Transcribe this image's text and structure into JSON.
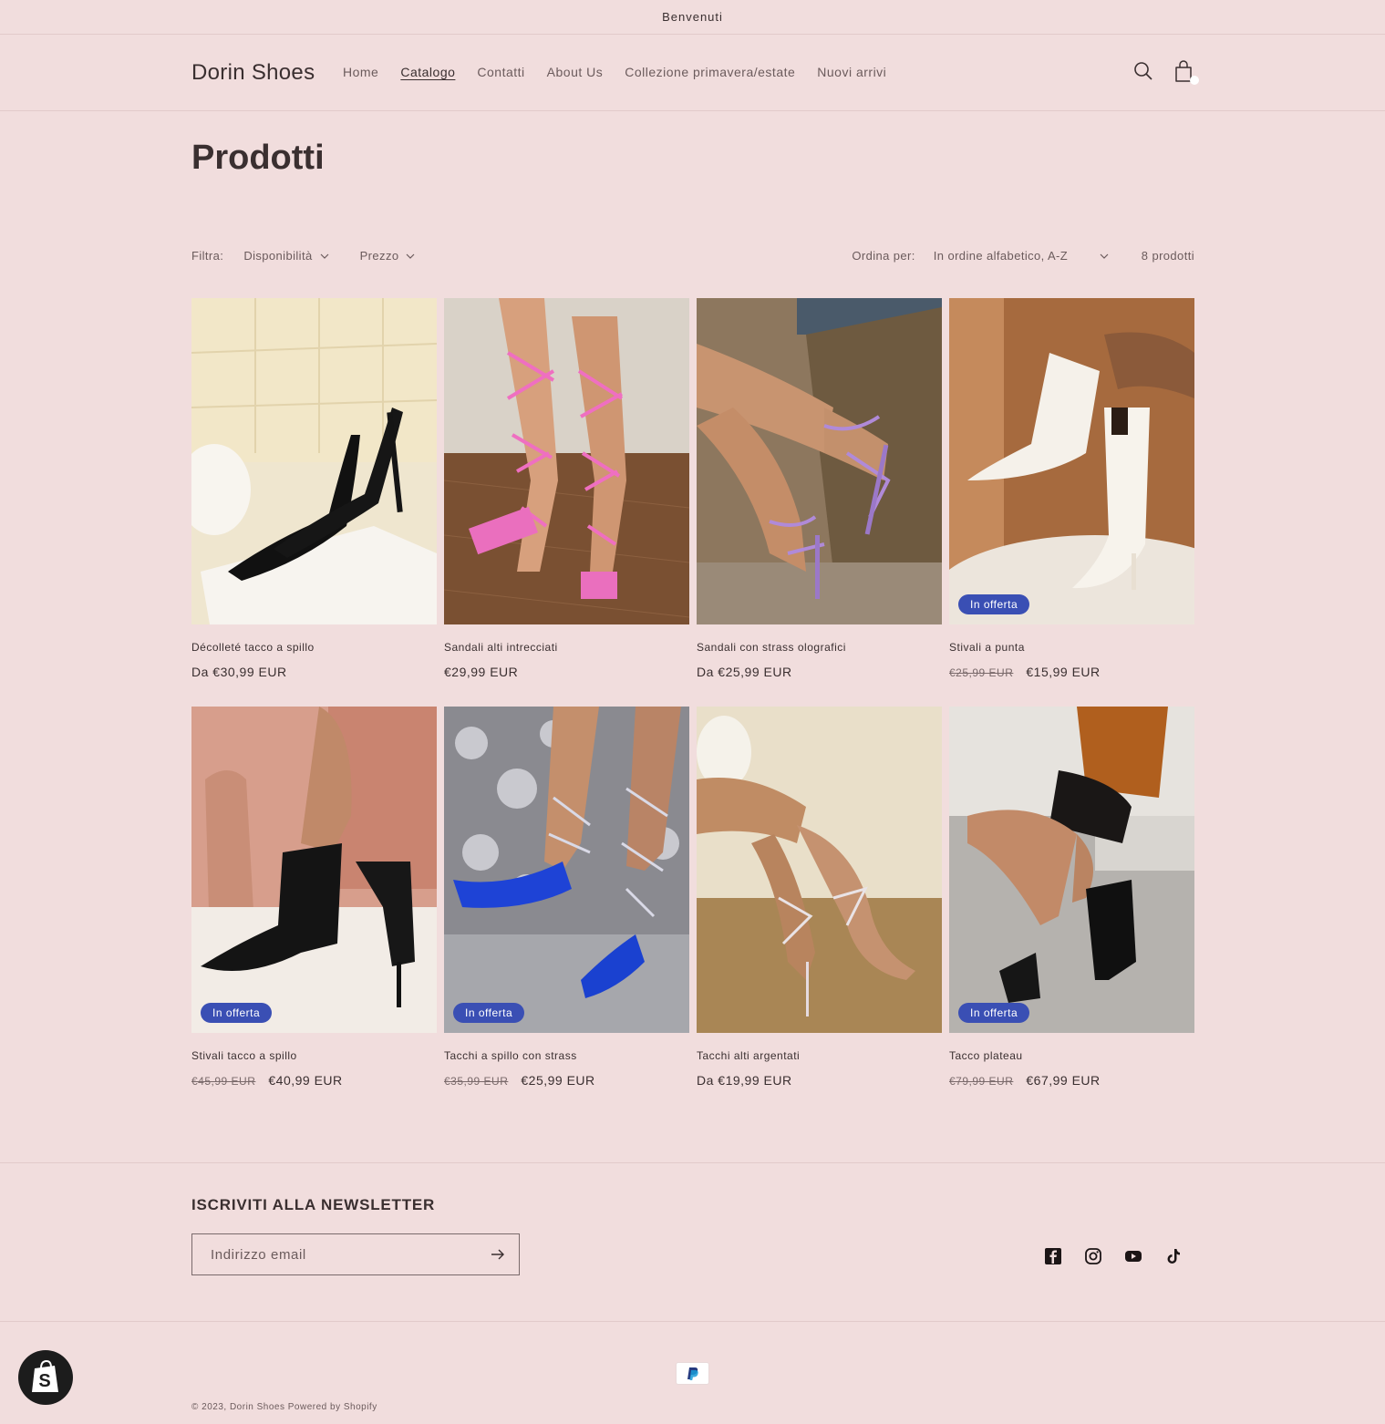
{
  "announcement": "Benvenuti",
  "header": {
    "logo": "Dorin Shoes",
    "nav": [
      "Home",
      "Catalogo",
      "Contatti",
      "About Us",
      "Collezione primavera/estate",
      "Nuovi arrivi"
    ],
    "active_nav": "Catalogo",
    "icons": [
      "search-icon",
      "cart-icon"
    ]
  },
  "page_title": "Prodotti",
  "toolbar": {
    "filter_label": "Filtra:",
    "filters": [
      "Disponibilità",
      "Prezzo"
    ],
    "sort_label": "Ordina per:",
    "sort_value": "In ordine alfabetico, A-Z",
    "count": "8 prodotti"
  },
  "products": [
    {
      "title": "Décolleté tacco a spillo",
      "price": "Da €30,99 EUR",
      "old_price": "",
      "badge": ""
    },
    {
      "title": "Sandali alti intrecciati",
      "price": "€29,99 EUR",
      "old_price": "",
      "badge": ""
    },
    {
      "title": "Sandali con strass olografici",
      "price": "Da €25,99 EUR",
      "old_price": "",
      "badge": ""
    },
    {
      "title": "Stivali a punta",
      "price": "€15,99 EUR",
      "old_price": "€25,99 EUR",
      "badge": "In offerta"
    },
    {
      "title": "Stivali tacco a spillo",
      "price": "€40,99 EUR",
      "old_price": "€45,99 EUR",
      "badge": "In offerta"
    },
    {
      "title": "Tacchi a spillo con strass",
      "price": "€25,99 EUR",
      "old_price": "€35,99 EUR",
      "badge": "In offerta"
    },
    {
      "title": "Tacchi alti argentati",
      "price": "Da €19,99 EUR",
      "old_price": "",
      "badge": ""
    },
    {
      "title": "Tacco plateau",
      "price": "€67,99 EUR",
      "old_price": "€79,99 EUR",
      "badge": "In offerta"
    }
  ],
  "footer": {
    "newsletter_title": "ISCRIVITI ALLA NEWSLETTER",
    "email_placeholder": "Indirizzo email",
    "socials": [
      "facebook-icon",
      "instagram-icon",
      "youtube-icon",
      "tiktok-icon"
    ],
    "payment": "paypal-icon",
    "copyright": "© 2023, Dorin Shoes Powered by Shopify"
  },
  "colors": {
    "background": "#f1dddd",
    "text": "#3a2f30",
    "badge": "#3a4fb4"
  }
}
